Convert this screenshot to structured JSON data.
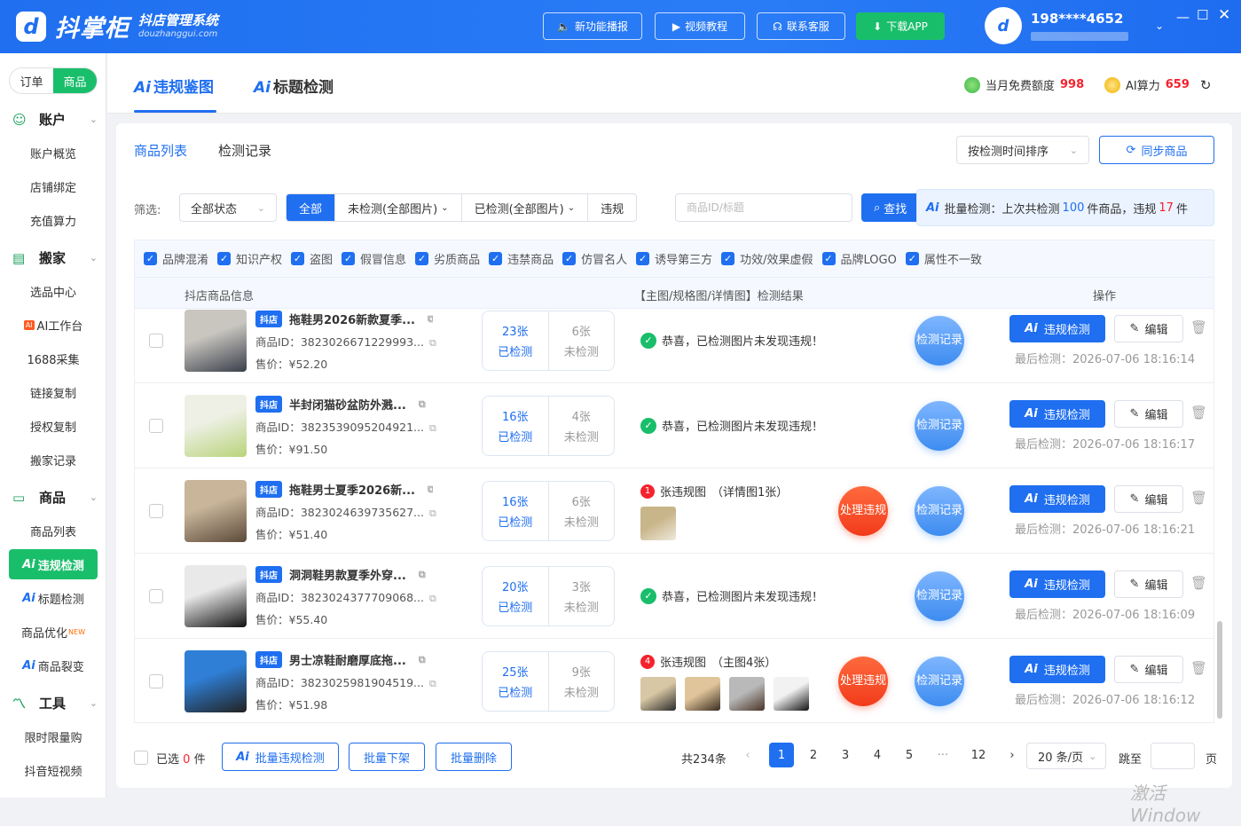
{
  "app": {
    "logo_glyph": "d",
    "name": "抖掌柜",
    "subtitle": "抖店管理系统",
    "domain": "douzhanggui.com"
  },
  "topbar": {
    "buttons": [
      "新功能播报",
      "视频教程",
      "联系客服",
      "下载APP"
    ],
    "user_phone": "198****4652",
    "avatar_glyph": "d"
  },
  "sidebar": {
    "segments": [
      "订单",
      "商品"
    ],
    "groups": [
      {
        "label": "账户",
        "icon": "smile-icon",
        "items": [
          "账户概览",
          "店铺绑定",
          "充值算力"
        ]
      },
      {
        "label": "搬家",
        "icon": "box-icon",
        "items": [
          "选品中心",
          "AI工作台",
          "1688采集",
          "链接复制",
          "授权复制",
          "搬家记录"
        ]
      },
      {
        "label": "商品",
        "icon": "bag-icon",
        "items": [
          "商品列表",
          "违规检测",
          "标题检测",
          "商品优化",
          "商品裂变"
        ]
      },
      {
        "label": "工具",
        "icon": "chart-icon",
        "items": [
          "限时限量购",
          "抖音短视频"
        ]
      }
    ],
    "ai_prefix": "Ai",
    "new_tag": "NEW"
  },
  "header": {
    "tabs": [
      "违规鉴图",
      "标题检测"
    ],
    "ai_prefix": "Ai",
    "quota_label": "当月免费额度",
    "quota_value": "998",
    "power_label": "AI算力",
    "power_value": "659"
  },
  "panel": {
    "subtabs": [
      "商品列表",
      "检测记录"
    ],
    "sort_label": "按检测时间排序",
    "sync_label": "同步商品",
    "filter_label": "筛选:",
    "status_select": "全部状态",
    "filter_buttons": [
      "全部",
      "未检测(全部图片)",
      "已检测(全部图片)",
      "违规"
    ],
    "search_placeholder": "商品ID/标题",
    "search_label": "查找",
    "batch_info": {
      "prefix": "批量检测：上次共检测",
      "count": "100",
      "mid": "件商品，违规",
      "violations": "17",
      "suffix": "件"
    },
    "categories": [
      "品牌混淆",
      "知识产权",
      "盗图",
      "假冒信息",
      "劣质商品",
      "违禁商品",
      "仿冒名人",
      "诱导第三方",
      "功效/效果虚假",
      "品牌LOGO",
      "属性不一致"
    ],
    "columns": [
      "抖店商品信息",
      "【主图/规格图/详情图】检测结果",
      "操作"
    ],
    "row_labels": {
      "shop_tag": "抖店",
      "id_prefix": "商品ID：",
      "price_prefix": "售价：",
      "checked": "已检测",
      "unchecked": "未检测",
      "ok_text": "恭喜，已检测图片未发现违规！",
      "handle": [
        "处理",
        "违规"
      ],
      "record": [
        "检测",
        "记录"
      ],
      "detect_btn": "违规检测",
      "edit_btn": "编辑",
      "last_prefix": "最后检测：",
      "viol_suffix": "张违规图"
    },
    "rows": [
      {
        "title": "拖鞋男2026新款夏季...",
        "id": "3823026671229993...",
        "price": "¥52.20",
        "checked": "23张",
        "unchecked": "6张",
        "status": "ok",
        "last": "2026-07-06 18:16:14",
        "palette": [
          "#3a3f4a",
          "#c9c6c0"
        ]
      },
      {
        "title": "半封闭猫砂盆防外溅...",
        "id": "3823539095204921...",
        "price": "¥91.50",
        "checked": "16张",
        "unchecked": "4张",
        "status": "ok",
        "last": "2026-07-06 18:16:17",
        "palette": [
          "#b8d47a",
          "#eef0e6"
        ]
      },
      {
        "title": "拖鞋男士夏季2026新...",
        "id": "3823024639735627...",
        "price": "¥51.40",
        "checked": "16张",
        "unchecked": "6张",
        "status": "violation",
        "viol_count": "1",
        "viol_detail": "（详情图1张）",
        "thumb_palettes": [
          [
            "#efe9dc",
            "#c9b58a"
          ]
        ],
        "last": "2026-07-06 18:16:21",
        "palette": [
          "#5c4a3a",
          "#c8b59a"
        ]
      },
      {
        "title": "洞洞鞋男款夏季外穿...",
        "id": "3823024377709068...",
        "price": "¥55.40",
        "checked": "20张",
        "unchecked": "3张",
        "status": "ok",
        "last": "2026-07-06 18:16:09",
        "palette": [
          "#111111",
          "#e9e9e9"
        ]
      },
      {
        "title": "男士凉鞋耐磨厚底拖...",
        "id": "3823025981904519...",
        "price": "¥51.98",
        "checked": "25张",
        "unchecked": "9张",
        "status": "violation",
        "viol_count": "4",
        "viol_detail": "（主图4张）",
        "thumb_palettes": [
          [
            "#2b2b2b",
            "#d8c7a4"
          ],
          [
            "#3a2c22",
            "#e0c59a"
          ],
          [
            "#4a3325",
            "#b9b9b9"
          ],
          [
            "#111111",
            "#f2f2f2"
          ]
        ],
        "last": "2026-07-06 18:16:12",
        "palette": [
          "#222222",
          "#2f7fd6"
        ]
      }
    ],
    "footer": {
      "selected_prefix": "已选",
      "selected_count": "0",
      "selected_suffix": "件",
      "batch_detect": "批量违规检测",
      "batch_off": "批量下架",
      "batch_delete": "批量删除",
      "total": "共234条",
      "pages": [
        "1",
        "2",
        "3",
        "4",
        "5",
        "···",
        "12"
      ],
      "page_size": "20 条/页",
      "jump_label": "跳至",
      "page_unit": "页"
    }
  },
  "watermark": "激活 Window",
  "colors": {
    "primary": "#1f6ff0",
    "green": "#19be6b",
    "red": "#f5222d"
  }
}
